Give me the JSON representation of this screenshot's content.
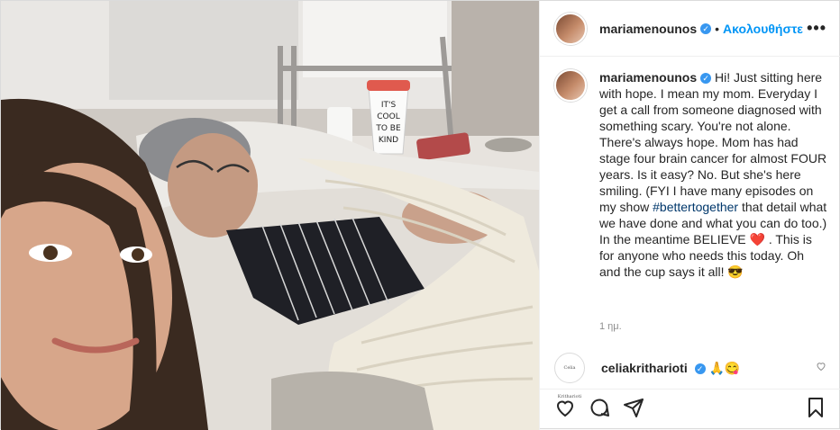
{
  "post": {
    "username": "mariamenounos",
    "follow_label": "Ακολουθήστε",
    "more_label": "•••"
  },
  "photo": {
    "cup_text": [
      "IT'S",
      "COOL",
      "TO BE",
      "KIND"
    ]
  },
  "caption": {
    "username": "mariamenounos",
    "part1": "Hi! Just sitting here with hope. I mean my mom. Everyday I get a call from someone diagnosed with something scary. You're not alone. There's always hope. Mom has had stage four brain cancer for almost FOUR years. Is it easy? No. But she's here smiling. (FYI I have many episodes on my show ",
    "hashtag": "#bettertogether",
    "part2": " that detail what we have done and what you can do too.) In the meantime BELIEVE ",
    "heart_emoji": "❤️",
    "part3": " . This is for anyone who needs this today. Oh and the cup says it all! ",
    "cool_emoji": "😎",
    "time": "1 ημ."
  },
  "comment": {
    "username": "celiakritharioti",
    "emojis": "🙏😋",
    "avatar_text": "Celia Kritharioti"
  },
  "colors": {
    "accent": "#0095f6",
    "verified": "#3897f0",
    "hashtag": "#00376b",
    "muted": "#8e8e8e"
  },
  "icons": [
    "heart-icon",
    "comment-icon",
    "share-icon",
    "bookmark-icon",
    "more-icon",
    "verified-badge-icon"
  ]
}
